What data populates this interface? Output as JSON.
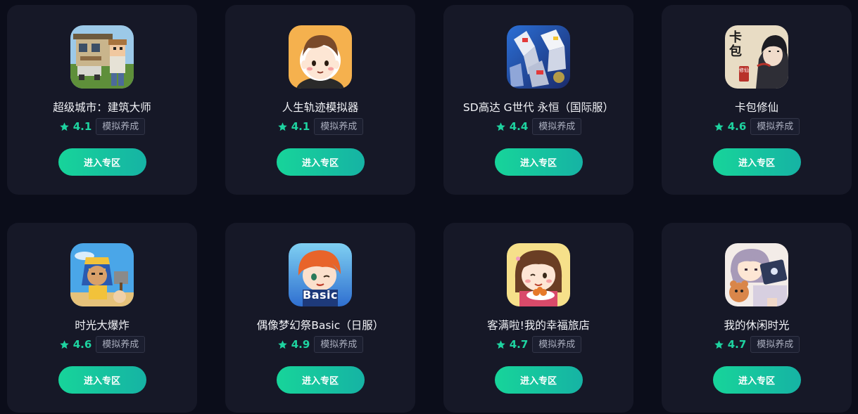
{
  "colors": {
    "background": "#0b0d1a",
    "card": "#161827",
    "accent": "#1ed3a0",
    "button_gradient": [
      "#17d49a",
      "#16b3a4"
    ]
  },
  "games": [
    {
      "name": "超级城市：建筑大师",
      "rating": "4.1",
      "tag": "模拟养成",
      "button": "进入专区",
      "icon": "minecraft-style-house-icon"
    },
    {
      "name": "人生轨迹模拟器",
      "rating": "4.1",
      "tag": "模拟养成",
      "button": "进入专区",
      "icon": "cartoon-boy-face-icon"
    },
    {
      "name": "SD高达 G世代 永恒（国际服）",
      "rating": "4.4",
      "tag": "模拟养成",
      "button": "进入专区",
      "icon": "gundam-robots-icon"
    },
    {
      "name": "卡包修仙",
      "rating": "4.6",
      "tag": "模拟养成",
      "button": "进入专区",
      "icon": "ink-cultivator-icon"
    },
    {
      "name": "时光大爆炸",
      "rating": "4.6",
      "tag": "模拟养成",
      "button": "进入专区",
      "icon": "pharaoh-character-icon"
    },
    {
      "name": "偶像梦幻祭Basic（日服）",
      "rating": "4.9",
      "tag": "模拟养成",
      "button": "进入专区",
      "icon": "anime-idol-boy-icon"
    },
    {
      "name": "客满啦!我的幸福旅店",
      "rating": "4.7",
      "tag": "模拟养成",
      "button": "进入专区",
      "icon": "chibi-girl-food-icon"
    },
    {
      "name": "我的休闲时光",
      "rating": "4.7",
      "tag": "模拟养成",
      "button": "进入专区",
      "icon": "girl-with-laptop-icon"
    }
  ],
  "icon_badges": {
    "card4_seal": "修仙",
    "card4_calligraphy": "卡包",
    "card6_logo": "Basic"
  }
}
